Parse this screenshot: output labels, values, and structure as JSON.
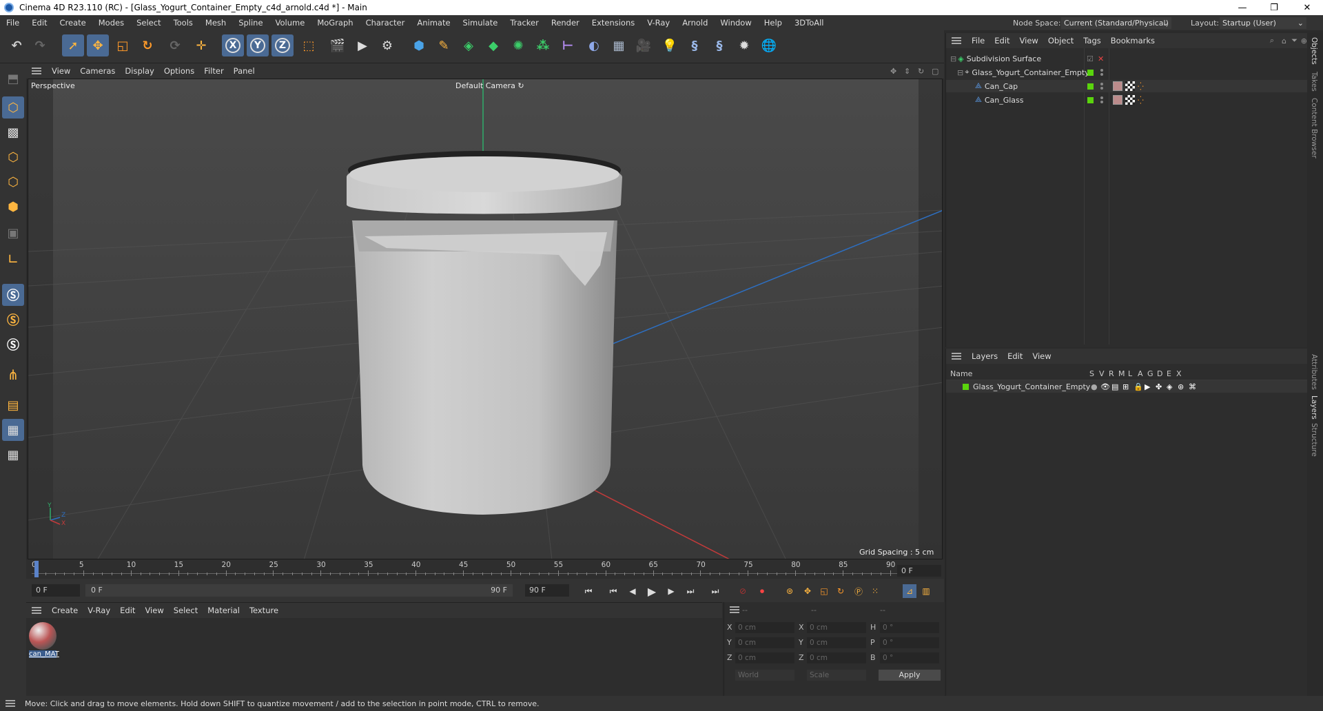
{
  "app": {
    "window_title": "Cinema 4D R23.110 (RC) - [Glass_Yogurt_Container_Empty_c4d_arnold.c4d *] - Main",
    "window_controls": [
      "—",
      "❐",
      "✕"
    ]
  },
  "menubar": {
    "items": [
      "File",
      "Edit",
      "Create",
      "Modes",
      "Select",
      "Tools",
      "Mesh",
      "Spline",
      "Volume",
      "MoGraph",
      "Character",
      "Animate",
      "Simulate",
      "Tracker",
      "Render",
      "Extensions",
      "V-Ray",
      "Arnold",
      "Window",
      "Help",
      "3DToAll"
    ],
    "node_space_label": "Node Space:",
    "node_space_value": "Current (Standard/Physical)",
    "layout_label": "Layout:",
    "layout_value": "Startup (User)"
  },
  "toolbar": {
    "axis_x": "X",
    "axis_y": "Y",
    "axis_z": "Z"
  },
  "viewport": {
    "menu": [
      "View",
      "Cameras",
      "Display",
      "Options",
      "Filter",
      "Panel"
    ],
    "view_name": "Perspective",
    "camera_label": "Default Camera",
    "grid_spacing": "Grid Spacing : 5 cm",
    "axis_y": "Y",
    "axis_z": "Z",
    "axis_x": "X"
  },
  "timeline": {
    "ticks": [
      "0",
      "5",
      "10",
      "15",
      "20",
      "25",
      "30",
      "35",
      "40",
      "45",
      "50",
      "55",
      "60",
      "65",
      "70",
      "75",
      "80",
      "85",
      "90"
    ],
    "current_frame": "0 F"
  },
  "playbar": {
    "start_field": "0 F",
    "range_start": "0 F",
    "range_end": "90 F",
    "end_field": "90 F"
  },
  "material_panel": {
    "menu": [
      "Create",
      "V-Ray",
      "Edit",
      "View",
      "Select",
      "Material",
      "Texture"
    ],
    "materials": [
      {
        "name": "can_MAT"
      }
    ]
  },
  "coord_panel": {
    "header": [
      "--",
      "--",
      "--"
    ],
    "rows": [
      {
        "l1": "X",
        "v1": "0 cm",
        "l2": "X",
        "v2": "0 cm",
        "l3": "H",
        "v3": "0 °"
      },
      {
        "l1": "Y",
        "v1": "0 cm",
        "l2": "Y",
        "v2": "0 cm",
        "l3": "P",
        "v3": "0 °"
      },
      {
        "l1": "Z",
        "v1": "0 cm",
        "l2": "Z",
        "v2": "0 cm",
        "l3": "B",
        "v3": "0 °"
      }
    ],
    "mode_world": "World",
    "mode_scale": "Scale",
    "apply_label": "Apply"
  },
  "object_manager": {
    "menu": [
      "File",
      "Edit",
      "View",
      "Object",
      "Tags",
      "Bookmarks"
    ],
    "objects": [
      {
        "name": "Subdivision Surface",
        "indent": 0
      },
      {
        "name": "Glass_Yogurt_Container_Empty",
        "indent": 1
      },
      {
        "name": "Can_Cap",
        "indent": 2
      },
      {
        "name": "Can_Glass",
        "indent": 2
      }
    ]
  },
  "layer_manager": {
    "menu": [
      "Layers",
      "Edit",
      "View"
    ],
    "name_header": "Name",
    "flag_headers": [
      "S",
      "V",
      "R",
      "M",
      "L",
      "A",
      "G",
      "D",
      "E",
      "X"
    ],
    "layers": [
      {
        "name": "Glass_Yogurt_Container_Empty",
        "color": "#5ad40d"
      }
    ]
  },
  "side_tabs": [
    "Objects",
    "Takes",
    "Content Browser",
    "Attributes",
    "Layers",
    "Structure"
  ],
  "status": {
    "message": "Move: Click and drag to move elements. Hold down SHIFT to quantize movement / add to the selection in point mode, CTRL to remove."
  },
  "colors": {
    "accent": "#4a6a94",
    "layer_green": "#5ad40d",
    "axis_green": "#2fae6a",
    "axis_red": "#c23a3a",
    "axis_blue": "#2d6fc2"
  }
}
